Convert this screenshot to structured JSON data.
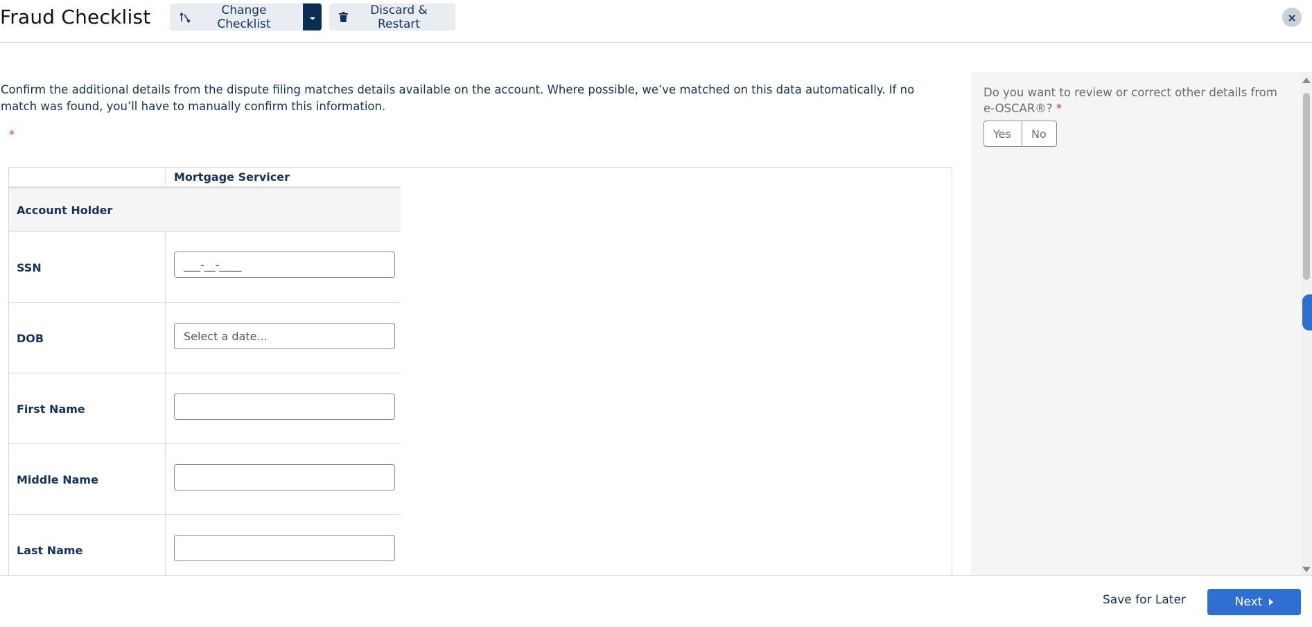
{
  "header": {
    "title": "Fraud Checklist",
    "change_checklist_label": "Change Checklist",
    "discard_restart_label": "Discard & Restart"
  },
  "main": {
    "intro_text": "Confirm the additional details from the dispute filing matches details available on the account. Where possible, we’ve matched on this data automatically. If no match was found, you’ll have to manually confirm this information.",
    "required_marker": "*",
    "table": {
      "column_header": "Mortgage Servicer",
      "section_label": "Account Holder",
      "rows": [
        {
          "label": "SSN",
          "placeholder": "___-__-____",
          "value": ""
        },
        {
          "label": "DOB",
          "placeholder": "Select a date...",
          "value": ""
        },
        {
          "label": "First Name",
          "placeholder": "",
          "value": ""
        },
        {
          "label": "Middle Name",
          "placeholder": "",
          "value": ""
        },
        {
          "label": "Last Name",
          "placeholder": "",
          "value": ""
        }
      ]
    }
  },
  "side_panel": {
    "question": "Do you want to review or correct other details from e-OSCAR®?",
    "required_marker": "*",
    "yes_label": "Yes",
    "no_label": "No"
  },
  "footer": {
    "save_later_label": "Save for Later",
    "next_label": "Next"
  },
  "colors": {
    "primary": "#2e6fd1",
    "navy": "#0b2d55",
    "text": "#16325c",
    "required": "#c23934"
  }
}
